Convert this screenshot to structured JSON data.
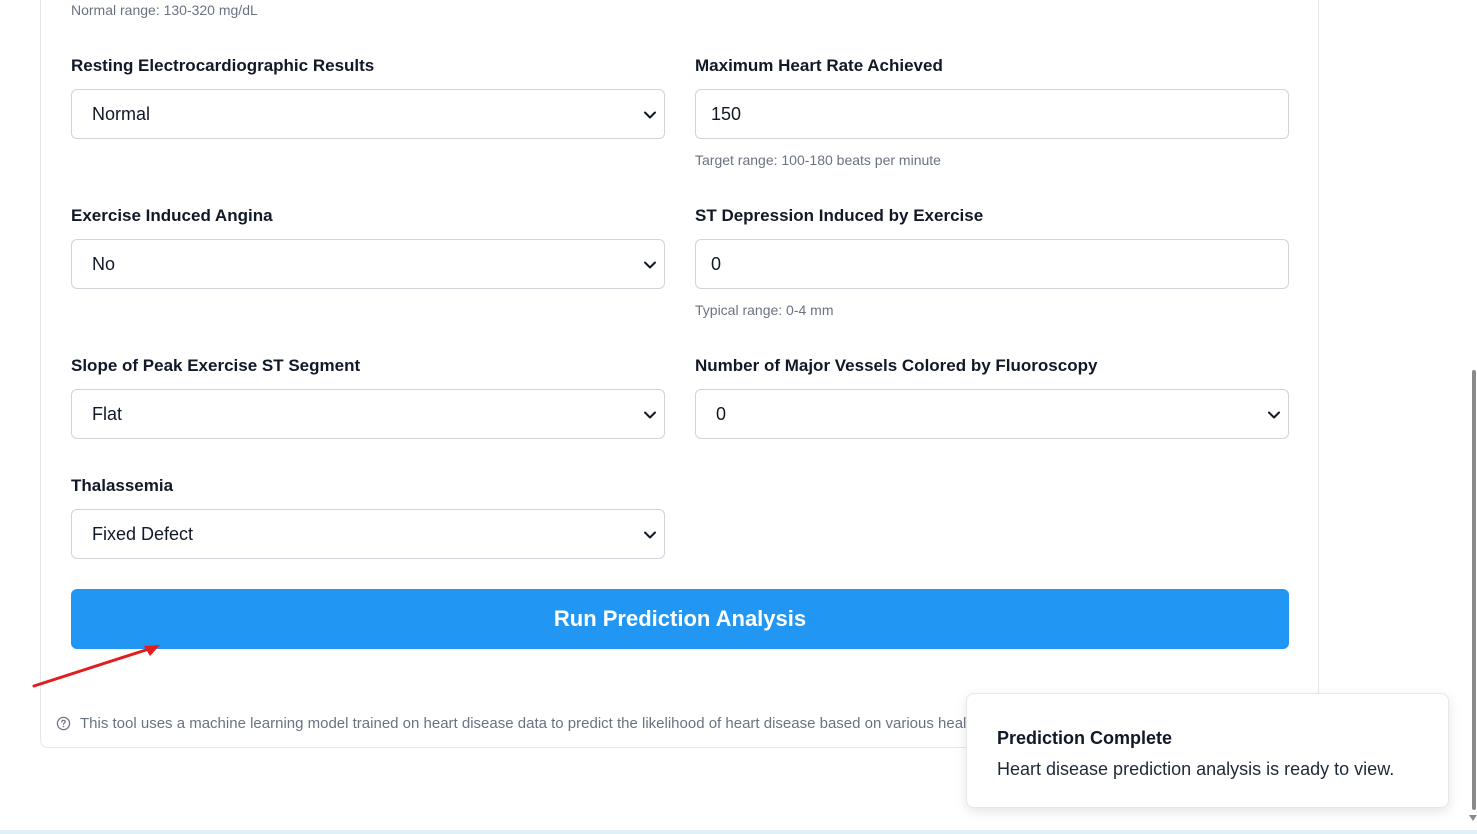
{
  "top_hint": "Normal range: 130-320 mg/dL",
  "fields": {
    "restecg": {
      "label": "Resting Electrocardiographic Results",
      "value": "Normal"
    },
    "thalach": {
      "label": "Maximum Heart Rate Achieved",
      "value": "150",
      "hint": "Target range: 100-180 beats per minute"
    },
    "exang": {
      "label": "Exercise Induced Angina",
      "value": "No"
    },
    "oldpeak": {
      "label": "ST Depression Induced by Exercise",
      "value": "0",
      "hint": "Typical range: 0-4 mm"
    },
    "slope": {
      "label": "Slope of Peak Exercise ST Segment",
      "value": "Flat"
    },
    "ca": {
      "label": "Number of Major Vessels Colored by Fluoroscopy",
      "value": "0"
    },
    "thal": {
      "label": "Thalassemia",
      "value": "Fixed Defect"
    }
  },
  "run_button": {
    "label": "Run Prediction Analysis"
  },
  "footer_note": "This tool uses a machine learning model trained on heart disease data to predict the likelihood of heart disease based on various healt",
  "toast": {
    "title": "Prediction Complete",
    "message": "Heart disease prediction analysis is ready to view."
  },
  "colors": {
    "accent": "#2196f3",
    "annotation_arrow": "#e11d1d"
  },
  "icons": {
    "select_chevron": "chevron-down-icon",
    "footer_info": "help-circle-icon"
  }
}
